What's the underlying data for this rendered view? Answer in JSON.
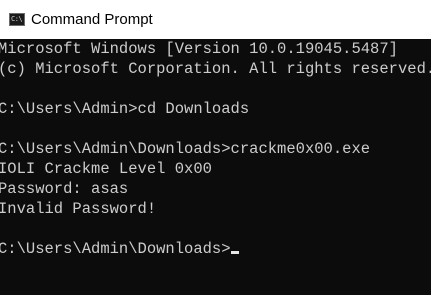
{
  "window": {
    "title": "Command Prompt",
    "icon": "cmd-icon",
    "icon_glyph": "C:\\"
  },
  "console": {
    "lines": [
      "Microsoft Windows [Version 10.0.19045.5487]",
      "(c) Microsoft Corporation. All rights reserved.",
      "",
      "C:\\Users\\Admin>cd Downloads",
      "",
      "C:\\Users\\Admin\\Downloads>crackme0x00.exe",
      "IOLI Crackme Level 0x00",
      "Password: asas",
      "Invalid Password!",
      "",
      "C:\\Users\\Admin\\Downloads>"
    ],
    "foreground": "#cccccc",
    "background": "#0c0c0c"
  }
}
